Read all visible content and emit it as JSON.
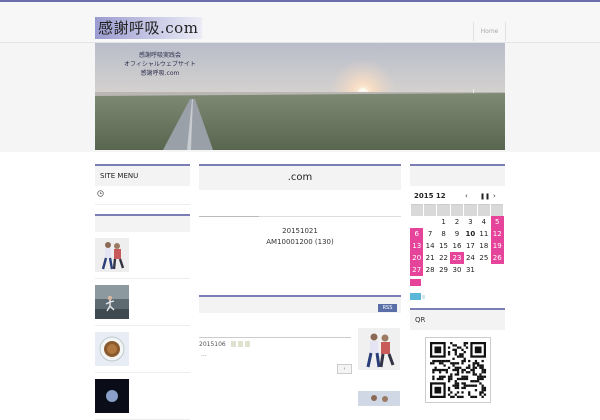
{
  "header": {
    "logo": "感謝呼吸.com",
    "home_label": "Home"
  },
  "banner": {
    "lines": [
      "感謝呼吸実践会",
      "オフィシャルウェブサイト",
      "感謝呼吸.com"
    ]
  },
  "left": {
    "site_menu_title": "SITE MENU",
    "menu_icon": "clock-icon"
  },
  "main": {
    "title": ".com",
    "info_line1": "20151021",
    "info_line2": "AM10001200 (130)",
    "rss_label": "RSS",
    "entry_date": "2015106",
    "entry_excerpt": "...",
    "next_arrow": "›"
  },
  "calendar": {
    "month_label": "2015 12",
    "prev": "‹",
    "pause": "❚❚",
    "next": "›",
    "today": 10,
    "holidays": [
      5,
      6,
      12,
      13,
      19,
      20,
      23,
      26,
      27
    ],
    "days": [
      "",
      "",
      "1",
      "2",
      "3",
      "4",
      "5",
      "6",
      "7",
      "8",
      "9",
      "10",
      "11",
      "12",
      "13",
      "14",
      "15",
      "16",
      "17",
      "18",
      "19",
      "20",
      "21",
      "22",
      "23",
      "24",
      "25",
      "26",
      "27",
      "28",
      "29",
      "30",
      "31",
      "",
      ""
    ],
    "holiday_color": "#e6449a",
    "event_color": "#5bb7da"
  },
  "qr": {
    "title": "QR"
  }
}
